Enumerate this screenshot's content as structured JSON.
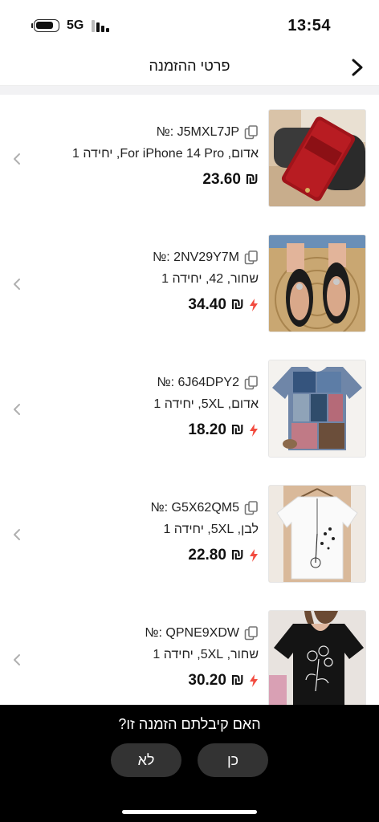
{
  "status": {
    "network": "5G",
    "time": "13:54"
  },
  "header": {
    "title": "פרטי ההזמנה"
  },
  "items": [
    {
      "number": "№: J5MXL7JP",
      "details": "אדום, For iPhone 14 Pro, יחידה 1",
      "price": "₪ 23.60",
      "flash": false,
      "image": "red-phone-wallet-case"
    },
    {
      "number": "№: 2NV29Y7M",
      "details": "שחור, 42, יחידה 1",
      "price": "₪ 34.40",
      "flash": true,
      "image": "black-sandals"
    },
    {
      "number": "№: 6J64DPY2",
      "details": "אדום, 5XL, יחידה 1",
      "price": "₪ 18.20",
      "flash": true,
      "image": "patchwork-blouse"
    },
    {
      "number": "№: G5X62QM5",
      "details": "לבן, 5XL, יחידה 1",
      "price": "₪ 22.80",
      "flash": true,
      "image": "white-dandelion-top"
    },
    {
      "number": "№: QPNE9XDW",
      "details": "שחור, 5XL, יחידה 1",
      "price": "₪ 30.20",
      "flash": true,
      "image": "black-floral-tshirt"
    }
  ],
  "prompt": {
    "question": "האם קיבלתם הזמנה זו?",
    "yes_label": "כן",
    "no_label": "לא"
  },
  "colors": {
    "flash": "#f24b3f",
    "sheet_bg": "#000000",
    "button_bg": "#333333"
  }
}
